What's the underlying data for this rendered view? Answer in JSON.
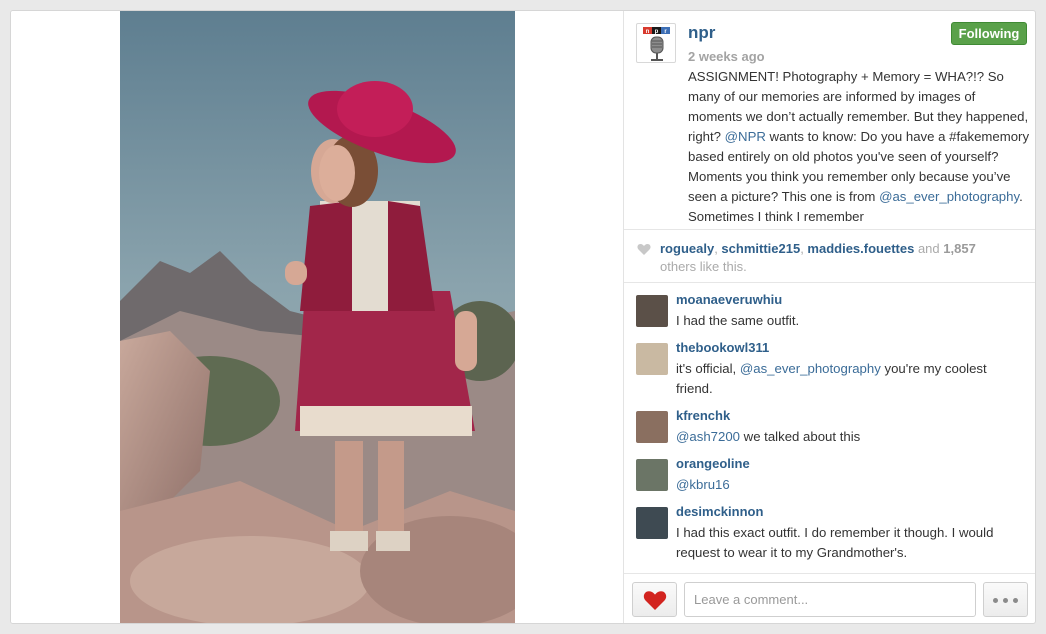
{
  "post": {
    "username": "npr",
    "avatar_label": "npr",
    "follow_label": "Following",
    "time": "2 weeks ago",
    "caption_parts": [
      {
        "t": "ASSIGNMENT! Photography + Memory = WHA?!? So many of our memories are informed by images of moments we don’t actually remember. But they happened, right? "
      },
      {
        "t": "@NPR",
        "m": true
      },
      {
        "t": " wants to know: Do you have a #fakememory based entirely on old photos you've seen of yourself? Moments you think you remember only because you’ve seen a picture? This one is from "
      },
      {
        "t": "@as_ever_photography",
        "m": true
      },
      {
        "t": ". Sometimes I think I remember"
      }
    ]
  },
  "likes": {
    "user1": "roguealy",
    "user2": "schmittie215",
    "user3": "maddies.fouettes",
    "and": " and ",
    "count": "1,857",
    "suffix": "others like this."
  },
  "comments": [
    {
      "user": "moanaeveruwhiu",
      "text": "I had the same outfit.",
      "avatar": "#5b5048"
    },
    {
      "user": "thebookowl311",
      "pre": "it's official, ",
      "mention": "@as_ever_photography",
      "post": " you're my coolest friend.",
      "avatar": "#c9b9a2"
    },
    {
      "user": "kfrenchk",
      "mention": "@ash7200",
      "post": " we talked about this",
      "avatar": "#8a6f60"
    },
    {
      "user": "orangeoline",
      "mention": "@kbru16",
      "post": "",
      "avatar": "#6b7566"
    },
    {
      "user": "desimckinnon",
      "text": "I had this exact outfit. I do remember it though. I would request to wear it to my Grandmother's.",
      "avatar": "#3e4a52"
    }
  ],
  "footer": {
    "comment_placeholder": "Leave a comment..."
  },
  "colors": {
    "link": "#2f5f8a",
    "follow_green": "#5aa14a",
    "heart_red": "#d2241f"
  },
  "icons": {
    "like": "heart-icon",
    "more": "more-dots-icon"
  }
}
